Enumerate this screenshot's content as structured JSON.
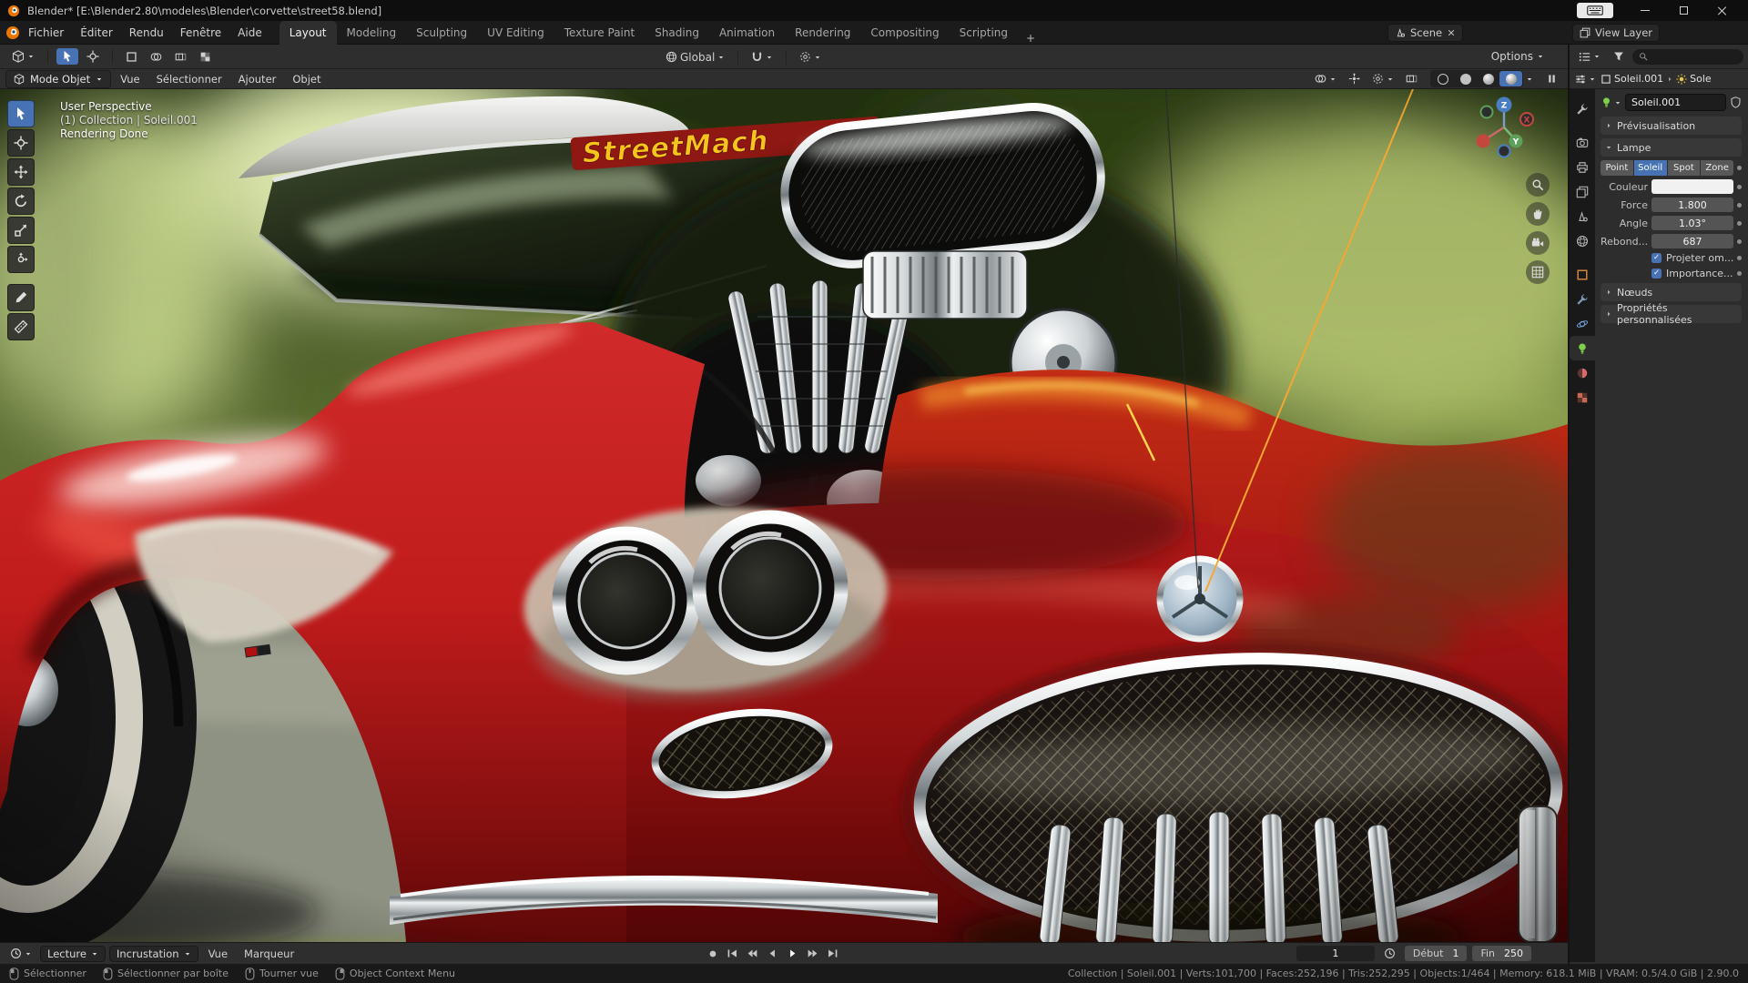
{
  "titlebar": {
    "title": "Blender* [E:\\Blender2.80\\modeles\\Blender\\corvette\\street58.blend]"
  },
  "topbar": {
    "menus": [
      "Fichier",
      "Éditer",
      "Rendu",
      "Fenêtre",
      "Aide"
    ],
    "workspaces": [
      "Layout",
      "Modeling",
      "Sculpting",
      "UV Editing",
      "Texture Paint",
      "Shading",
      "Animation",
      "Rendering",
      "Compositing",
      "Scripting"
    ],
    "add_workspace": "+",
    "scene_label": "Scene",
    "view_layer_label": "View Layer"
  },
  "tool_header": {
    "orientation": "Global",
    "options_label": "Options"
  },
  "viewport_header": {
    "mode": "Mode Objet",
    "menus": [
      "Vue",
      "Sélectionner",
      "Ajouter",
      "Objet"
    ]
  },
  "viewport": {
    "overlay": {
      "line1": "User Perspective",
      "line2": "(1) Collection | Soleil.001",
      "line3": "Rendering Done"
    },
    "banner_text": "StreetMach",
    "gizmo": {
      "x": "X",
      "y": "Y",
      "z": "Z"
    }
  },
  "properties": {
    "breadcrumb_object": "Soleil.001",
    "breadcrumb_data": "Sole",
    "name_value": "Soleil.001",
    "panel_preview": "Prévisualisation",
    "panel_lamp": "Lampe",
    "panel_nodes": "Nœuds",
    "panel_custom": "Propriétés personnalisées",
    "lamp": {
      "types": [
        "Point",
        "Soleil",
        "Spot",
        "Zone"
      ],
      "color_label": "Couleur",
      "force_label": "Force",
      "force_value": "1.800",
      "angle_label": "Angle",
      "angle_value": "1.03°",
      "bounces_label": "Rebond...",
      "bounces_value": "687",
      "check_shadow": "Projeter om...",
      "check_importance": "Importance..."
    }
  },
  "timeline": {
    "playback_label": "Lecture",
    "overlay_label": "Incrustation",
    "menus": [
      "Vue",
      "Marqueur"
    ],
    "current_frame": "1",
    "start_label": "Début",
    "start_value": "1",
    "end_label": "Fin",
    "end_value": "250"
  },
  "statusbar": {
    "hint_select": "Sélectionner",
    "hint_box": "Sélectionner par boîte",
    "hint_rotate": "Tourner vue",
    "hint_context": "Object Context Menu",
    "stats": "Collection | Soleil.001 | Verts:101,700 | Faces:252,196 | Tris:252,295 | Objects:1/464 | Memory: 618.1 MiB | VRAM: 0.5/4.0 GiB | 2.90.0"
  }
}
